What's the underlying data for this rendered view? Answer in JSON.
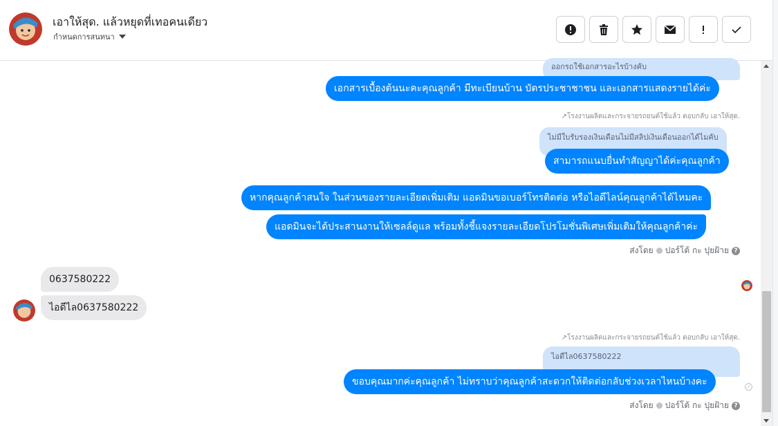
{
  "header": {
    "title": "เอาให้สุด. แล้วหยุดที่เทอคนเดียว",
    "subtitle": "กำหนดการสนทนา"
  },
  "toolbar": {
    "buttons": [
      {
        "icon": "alert-circle-icon"
      },
      {
        "icon": "trash-icon"
      },
      {
        "icon": "star-icon"
      },
      {
        "icon": "envelope-icon"
      },
      {
        "icon": "exclamation-icon"
      },
      {
        "icon": "check-icon"
      }
    ]
  },
  "thread": {
    "quote1": "ออกรถใช้เอกสารอะไรบ้างคับ",
    "msg1": "เอกสารเบื้องต้นนะคะคุณลูกค้า มีทะเบียนบ้าน บัตรประชาชาชน และเอกสารแสดงรายได้ค่ะ",
    "reply_meta1": "โรงงานผลิตและกระจายรถยนต์ใช้แล้ว ตอบกลับ เอาให้สุด.",
    "quote2": "ไม่มีใบรับรองเงินเดือนไม่มีสลิปเงินเดือนออกได้ไมคับ",
    "msg2": "สามารถแนบยื่นทำสัญญาได้ค่ะคุณลูกค้า",
    "msg3": "หากคุณลูกค้าสนใจ ในส่วนของรายละเอียดเพิ่มเติม แอดมินขอเบอร์โทรติดต่อ หรือไอดีไลน์คุณลูกค้าได้ไหมคะ",
    "msg4": "แอดมินจะได้ประสานงานให้เซลล์ดูแล พร้อมทั้งชี้แจงรายละเอียดโปรโมชั่นพิเศษเพิ่มเติมให้คุณลูกค้าค่ะ",
    "sent_by_label": "ส่งโดย",
    "sent_by_name": "ปอร์โต้ กะ ปุยฝ้าย",
    "in1": "0637580222",
    "in2": "ไอดีไล0637580222",
    "reply_meta2": "โรงงานผลิตและกระจายรถยนต์ใช้แล้ว ตอบกลับ เอาให้สุด.",
    "quote3": "ไอดีไล0637580222",
    "msg5": "ขอบคุณมากค่ะคุณลูกค้า ไม่ทราบว่าคุณลูกค้าสะดวกให้ติดต่อกลับช่วงเวลาไหนบ้างคะ"
  },
  "colors": {
    "outgoing": "#0084ff",
    "incoming": "#e9e9eb",
    "quote": "#cfe3fb"
  }
}
